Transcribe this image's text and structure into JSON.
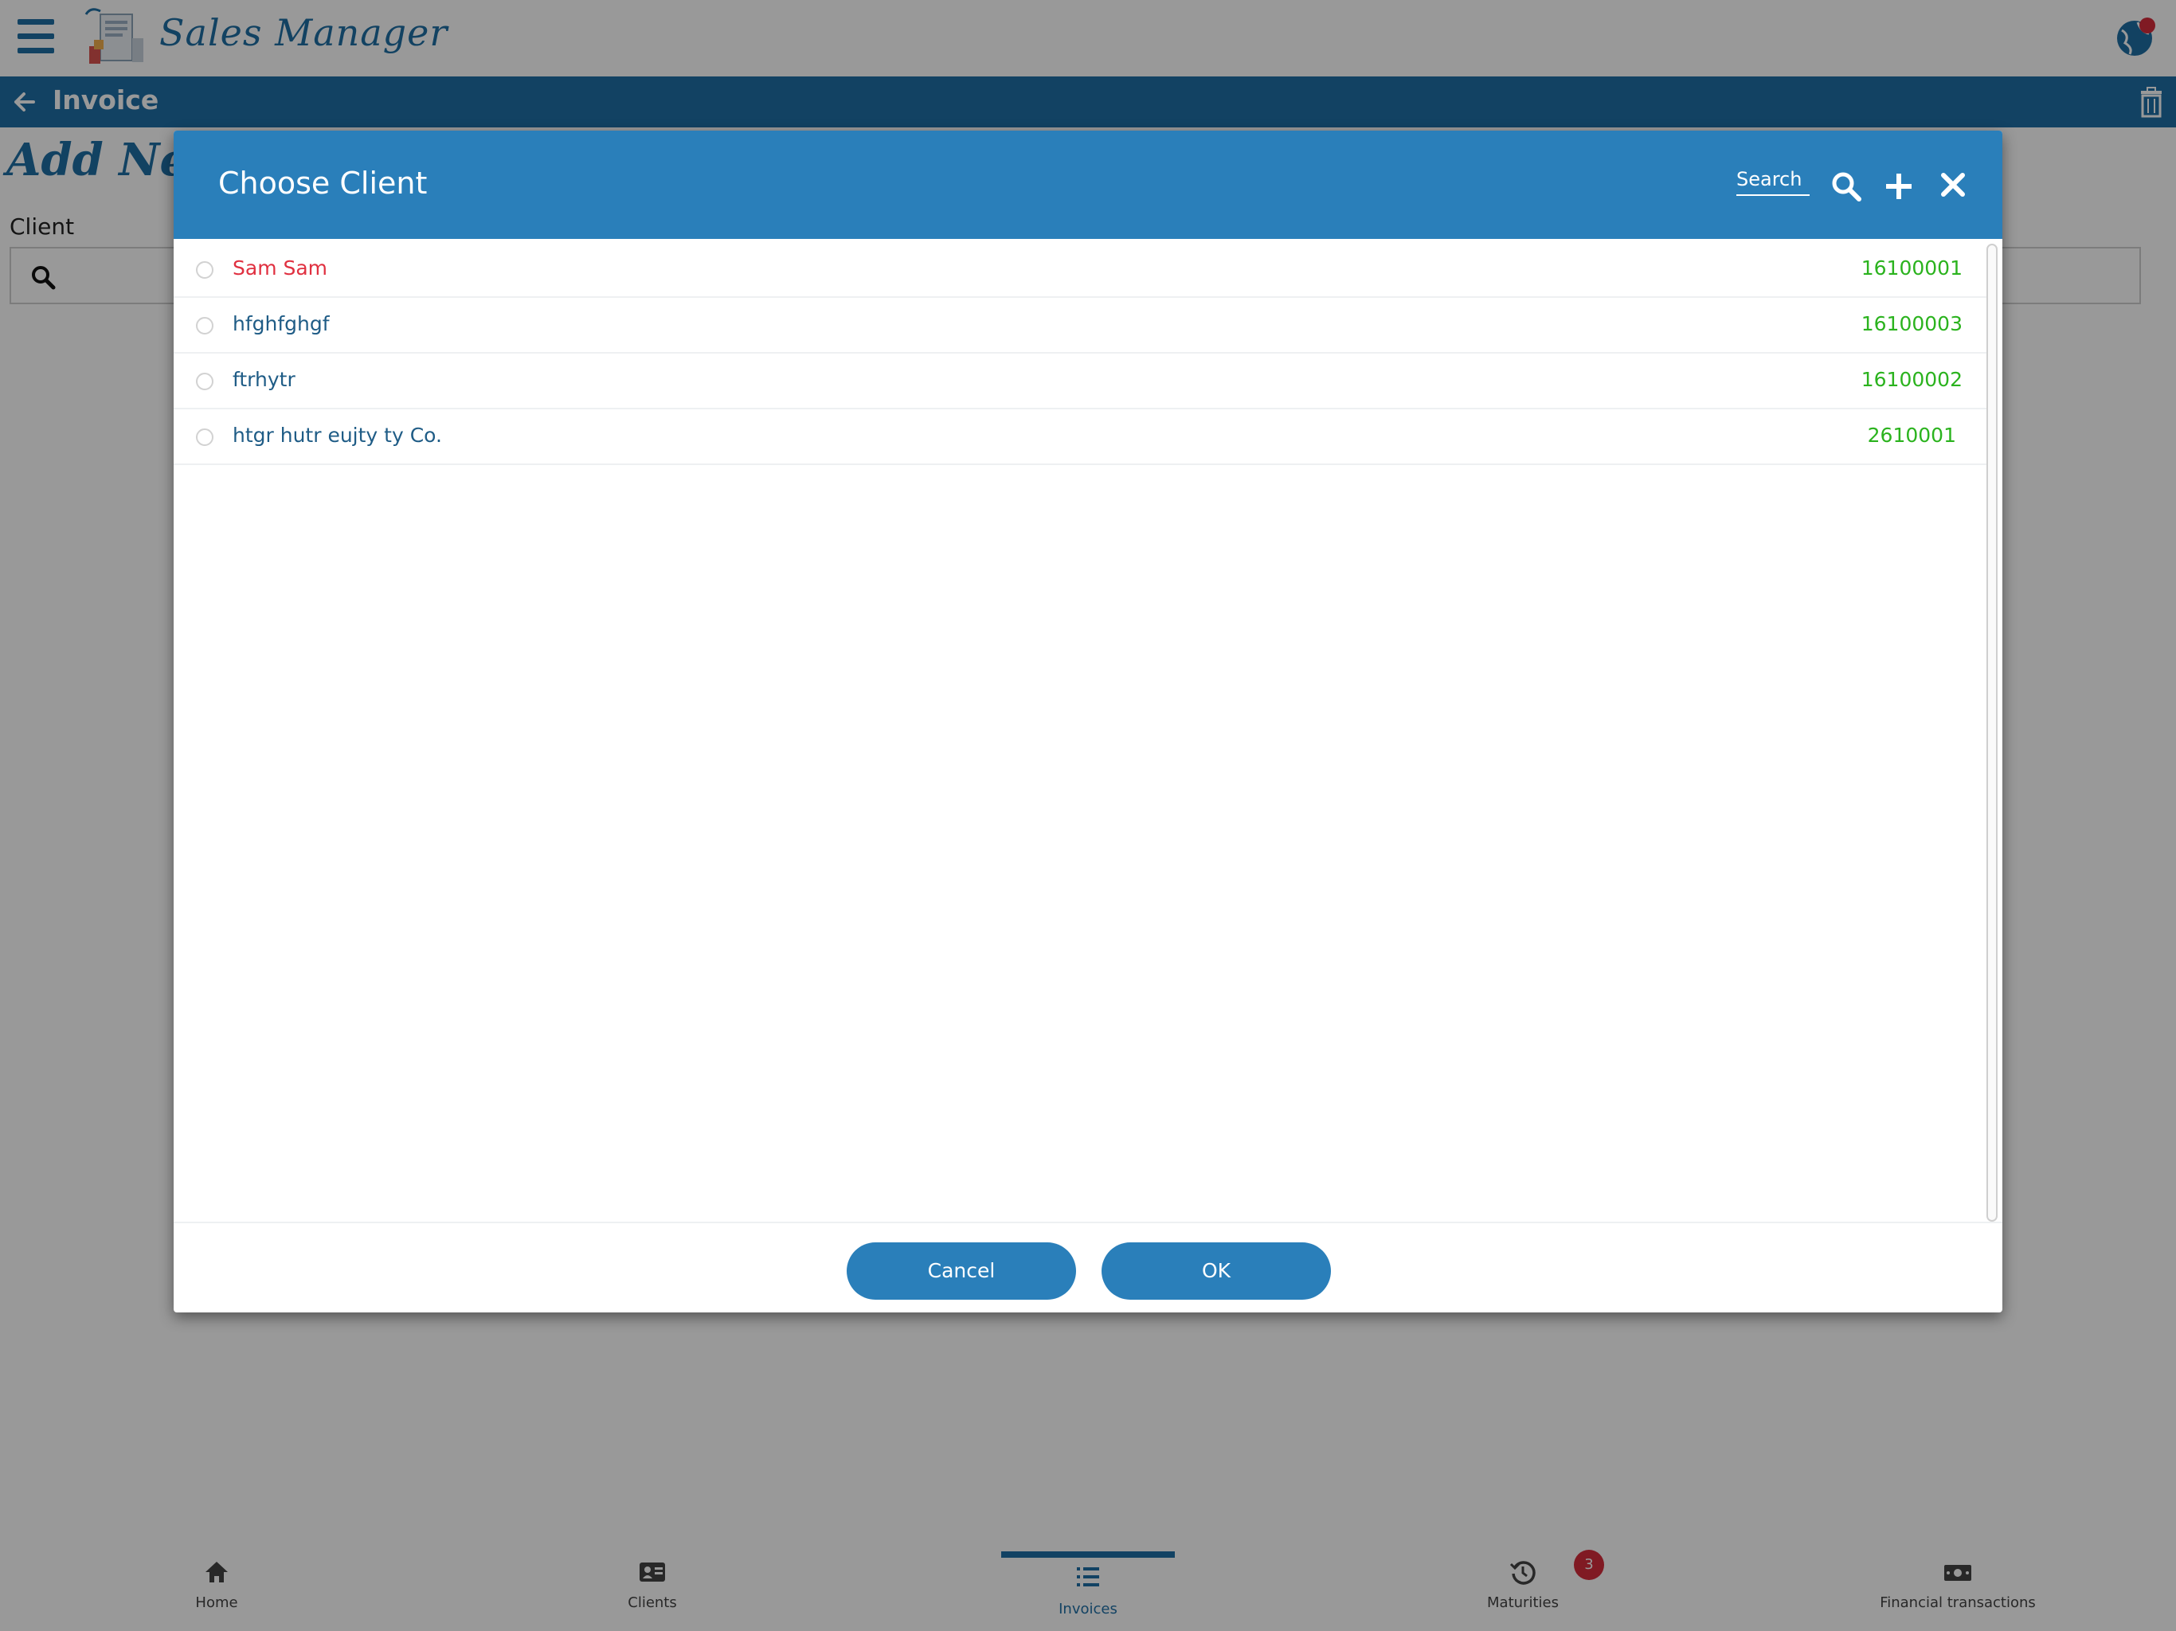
{
  "app": {
    "title": "Sales Manager"
  },
  "page": {
    "title": "Invoice",
    "heading": "Add New",
    "client_label": "Client"
  },
  "dialog": {
    "title": "Choose Client",
    "search_placeholder": "Search",
    "clients": [
      {
        "name": "Sam Sam",
        "code": "16100001",
        "name_color": "#e03040"
      },
      {
        "name": "hfghfghgf",
        "code": "16100003",
        "name_color": "#1f5c86"
      },
      {
        "name": "ftrhytr",
        "code": "16100002",
        "name_color": "#1f5c86"
      },
      {
        "name": "htgr hutr eujty ty Co.",
        "code": "2610001",
        "name_color": "#1f5c86"
      }
    ],
    "cancel_label": "Cancel",
    "ok_label": "OK"
  },
  "tabs": [
    {
      "label": "Home",
      "icon": "home-icon"
    },
    {
      "label": "Clients",
      "icon": "id-card-icon"
    },
    {
      "label": "Invoices",
      "icon": "list-icon",
      "active": true
    },
    {
      "label": "Maturities",
      "icon": "history-icon",
      "badge": "3"
    },
    {
      "label": "Financial transactions",
      "icon": "money-icon"
    }
  ],
  "colors": {
    "primary": "#1f6fa5",
    "dialog_header": "#2a7fba",
    "code_green": "#2bb31e",
    "badge_red": "#d62c3b"
  }
}
